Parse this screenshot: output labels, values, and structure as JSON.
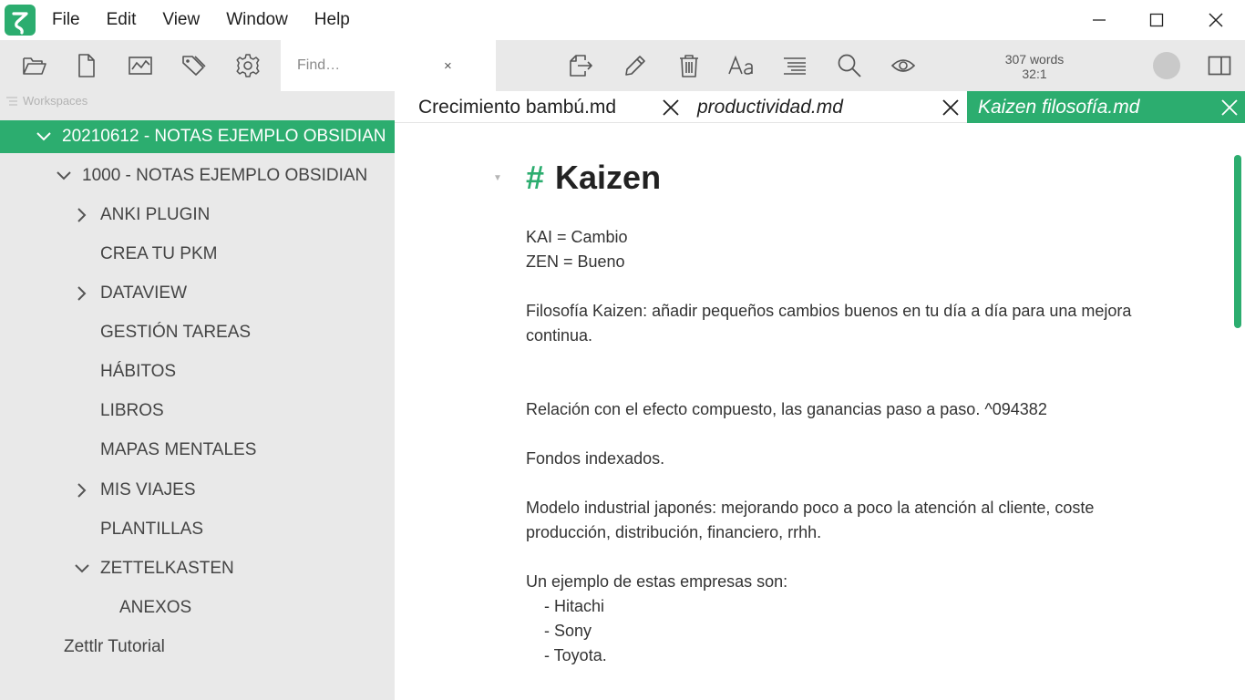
{
  "menu": {
    "items": [
      "File",
      "Edit",
      "View",
      "Window",
      "Help"
    ]
  },
  "toolbar": {
    "search_placeholder": "Find…",
    "clear_glyph": "×",
    "word_count": "307 words",
    "cursor_position": "32:1"
  },
  "sidebar": {
    "workspaces_label": "Workspaces",
    "items": [
      {
        "label": "20210612 - NOTAS EJEMPLO OBSIDIAN",
        "expanded": true,
        "active": true
      },
      {
        "label": "1000 - NOTAS EJEMPLO OBSIDIAN",
        "expanded": true
      },
      {
        "label": "ANKI PLUGIN",
        "expanded": false
      },
      {
        "label": "CREA TU PKM"
      },
      {
        "label": "DATAVIEW",
        "expanded": false
      },
      {
        "label": "GESTIÓN TAREAS"
      },
      {
        "label": "HÁBITOS"
      },
      {
        "label": "LIBROS"
      },
      {
        "label": "MAPAS MENTALES"
      },
      {
        "label": "MIS VIAJES",
        "expanded": false
      },
      {
        "label": "PLANTILLAS"
      },
      {
        "label": "ZETTELKASTEN",
        "expanded": true
      },
      {
        "label": "ANEXOS"
      },
      {
        "label": "Zettlr Tutorial"
      }
    ]
  },
  "tabs": [
    {
      "label": "Crecimiento bambú.md",
      "italic": false,
      "active": false
    },
    {
      "label": "productividad.md",
      "italic": true,
      "active": false
    },
    {
      "label": "Kaizen filosofía.md",
      "italic": true,
      "active": true
    }
  ],
  "editor": {
    "heading_marker": "#",
    "heading": "Kaizen",
    "lines": [
      "KAI = Cambio",
      "ZEN = Bueno",
      "Filosofía Kaizen: añadir pequeños cambios buenos en tu día a día para una mejora",
      "continua.",
      "Relación con el efecto compuesto, las ganancias paso a paso. ^094382",
      "Fondos indexados.",
      "Modelo industrial japonés: mejorando poco a poco la atención al cliente, coste",
      "producción, distribución, financiero, rrhh.",
      "Un ejemplo de estas empresas son:",
      "    - Hitachi",
      "    - Sony",
      "    - Toyota."
    ]
  },
  "colors": {
    "accent": "#2cad6f",
    "sidebar_bg": "#e9e9e9"
  }
}
